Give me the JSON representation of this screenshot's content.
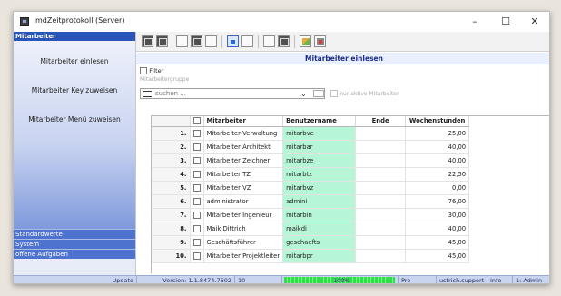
{
  "window": {
    "title": "mdZeitprotokoll (Server)",
    "minimize": "–",
    "maximize": "☐",
    "close": "✕"
  },
  "sidebar": {
    "header": "Mitarbeiter",
    "items": [
      {
        "label": "Mitarbeiter einlesen"
      },
      {
        "label": "Mitarbeiter Key zuweisen"
      },
      {
        "label": "Mitarbeiter Menü zuweisen"
      }
    ],
    "sections": [
      {
        "label": "Standardwerte"
      },
      {
        "label": "System"
      },
      {
        "label": "offene Aufgaben"
      }
    ]
  },
  "main": {
    "title": "Mitarbeiter einlesen",
    "filter_label": "Filter",
    "group_label": "Mitarbeitergruppe",
    "search_placeholder": "suchen ...",
    "dots": "..",
    "active_only_label": "nur aktive Mitarbeiter"
  },
  "table": {
    "headers": {
      "name": "Mitarbeiter",
      "user": "Benutzername",
      "end": "Ende",
      "hours": "Wochenstunden"
    },
    "rows": [
      {
        "num": "1.",
        "name": "Mitarbeiter Verwaltung",
        "user": "mitarbve",
        "end": "",
        "hours": "25,00"
      },
      {
        "num": "2.",
        "name": "Mitarbeiter Architekt",
        "user": "mitarbar",
        "end": "",
        "hours": "40,00"
      },
      {
        "num": "3.",
        "name": "Mitarbeiter Zeichner",
        "user": "mitarbze",
        "end": "",
        "hours": "40,00"
      },
      {
        "num": "4.",
        "name": "Mitarbeiter TZ",
        "user": "mitarbtz",
        "end": "",
        "hours": "22,50"
      },
      {
        "num": "5.",
        "name": "Mitarbeiter VZ",
        "user": "mitarbvz",
        "end": "",
        "hours": "0,00"
      },
      {
        "num": "6.",
        "name": "administrator",
        "user": "admini",
        "end": "",
        "hours": "76,00"
      },
      {
        "num": "7.",
        "name": "Mitarbeiter Ingenieur",
        "user": "mitarbin",
        "end": "",
        "hours": "30,00"
      },
      {
        "num": "8.",
        "name": "Maik Dittrich",
        "user": "maikdi",
        "end": "",
        "hours": "40,00"
      },
      {
        "num": "9.",
        "name": "Geschäftsführer",
        "user": "geschaefts",
        "end": "",
        "hours": "45,00"
      },
      {
        "num": "10.",
        "name": "Mitarbeiter Projektleiter",
        "user": "mitarbpr",
        "end": "",
        "hours": "45,00"
      }
    ]
  },
  "status": {
    "update": "Update",
    "version": "Version: 1.1.8474.7602",
    "count": "10",
    "progress": 1.0,
    "progress_label": "100%",
    "edition": "Pro",
    "user": "ustrich.support",
    "info": "Info",
    "role": "1: Admin"
  },
  "colors": {
    "sidebar_header": "#2a55b8",
    "highlight_user": "#b6f5d6",
    "progress": "#2ee04a"
  }
}
